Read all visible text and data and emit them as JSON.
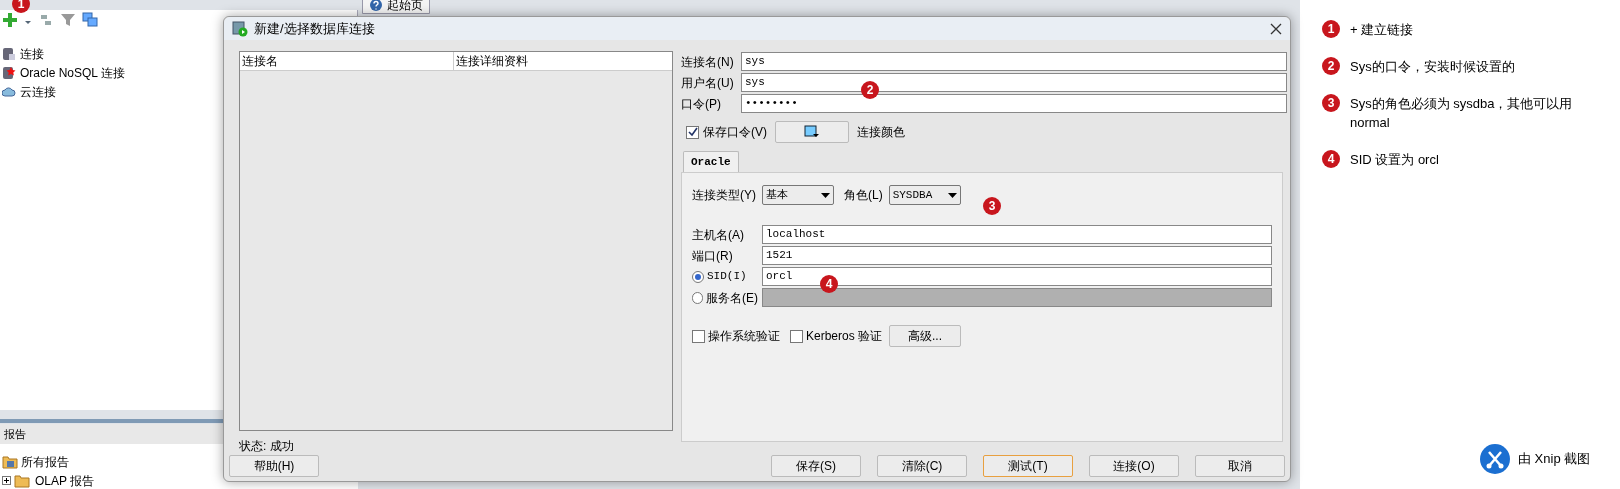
{
  "app": {
    "start_tab": "起始页",
    "connections": [
      {
        "label": "连接",
        "kind": "db"
      },
      {
        "label": "Oracle NoSQL 连接",
        "kind": "nosql"
      },
      {
        "label": "云连接",
        "kind": "cloud"
      }
    ],
    "reports": {
      "title": "报告",
      "items": [
        {
          "label": "所有报告",
          "kind": "reports",
          "expander": false
        },
        {
          "label": "OLAP 报告",
          "kind": "folder",
          "expander": true
        }
      ]
    }
  },
  "dialog": {
    "title": "新建/选择数据库连接",
    "columns": [
      "连接名",
      "连接详细资料"
    ],
    "connection_name": {
      "label": "连接名(N)",
      "value": "sys"
    },
    "username": {
      "label": "用户名(U)",
      "value": "sys"
    },
    "password": {
      "label": "口令(P)",
      "value": "••••••••"
    },
    "save_password": {
      "label": "保存口令(V)",
      "checked": true
    },
    "color_label": "连接颜色",
    "tab": {
      "label": "Oracle",
      "selected": true
    },
    "conn_type": {
      "label": "连接类型(Y)",
      "value": "基本"
    },
    "role": {
      "label": "角色(L)",
      "value": "SYSDBA"
    },
    "host": {
      "label": "主机名(A)",
      "value": "localhost"
    },
    "port": {
      "label": "端口(R)",
      "value": "1521"
    },
    "sid": {
      "label": "SID(I)",
      "value": "orcl",
      "selected": true
    },
    "service": {
      "label": "服务名(E)",
      "selected": false,
      "disabled": true
    },
    "os_auth": {
      "label": "操作系统验证",
      "checked": false
    },
    "kerberos": {
      "label": "Kerberos 验证",
      "checked": false
    },
    "advanced": "高级...",
    "status": "状态: 成功",
    "help": "帮助(H)",
    "buttons": [
      {
        "label": "保存(S)",
        "focused": false
      },
      {
        "label": "清除(C)",
        "focused": false
      },
      {
        "label": "测试(T)",
        "focused": true
      },
      {
        "label": "连接(O)",
        "focused": false
      },
      {
        "label": "取消",
        "focused": false
      }
    ]
  },
  "markers": [
    "1",
    "2",
    "3",
    "4"
  ],
  "annotations": [
    {
      "number": "1",
      "text": "+ 建立链接"
    },
    {
      "number": "2",
      "text": "Sys的口令，安装时候设置的"
    },
    {
      "number": "3",
      "text": "Sys的角色必须为 sysdba，其他可以用 normal"
    },
    {
      "number": "4",
      "text": "SID 设置为 orcl"
    }
  ],
  "credit": "由 Xnip 截图"
}
